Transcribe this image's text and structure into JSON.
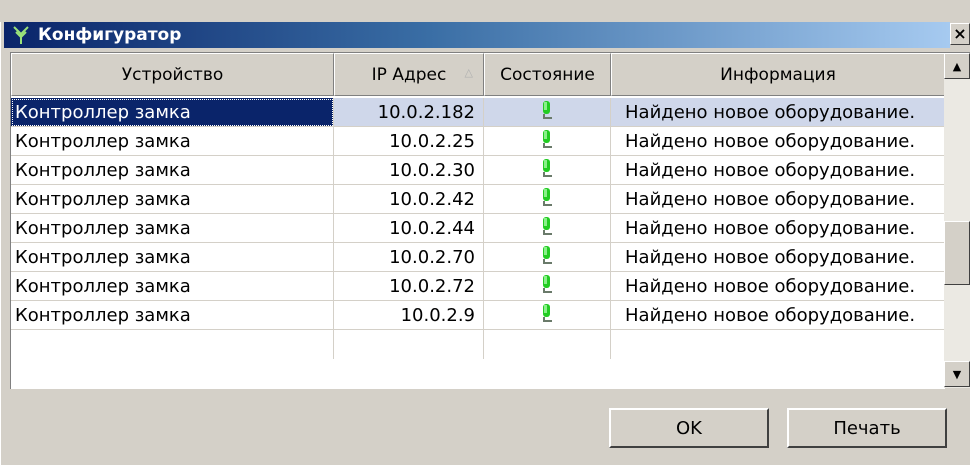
{
  "window": {
    "title": "Конфигуратор",
    "close_label": "×",
    "icon": "branch-network-icon"
  },
  "table": {
    "columns": [
      {
        "label": "Устройство"
      },
      {
        "label": "IP Адрес",
        "sort_indicator": "△"
      },
      {
        "label": "Состояние"
      },
      {
        "label": "Информация"
      }
    ],
    "rows": [
      {
        "device": "Контроллер замка",
        "ip": "10.0.2.182",
        "status_icon": "green-device-icon",
        "info": "Найдено новое оборудование."
      },
      {
        "device": "Контроллер замка",
        "ip": "10.0.2.25",
        "status_icon": "green-device-icon",
        "info": "Найдено новое оборудование."
      },
      {
        "device": "Контроллер замка",
        "ip": "10.0.2.30",
        "status_icon": "green-device-icon",
        "info": "Найдено новое оборудование."
      },
      {
        "device": "Контроллер замка",
        "ip": "10.0.2.42",
        "status_icon": "green-device-icon",
        "info": "Найдено новое оборудование."
      },
      {
        "device": "Контроллер замка",
        "ip": "10.0.2.44",
        "status_icon": "green-device-icon",
        "info": "Найдено новое оборудование."
      },
      {
        "device": "Контроллер замка",
        "ip": "10.0.2.70",
        "status_icon": "green-device-icon",
        "info": "Найдено новое оборудование."
      },
      {
        "device": "Контроллер замка",
        "ip": "10.0.2.72",
        "status_icon": "green-device-icon",
        "info": "Найдено новое оборудование."
      },
      {
        "device": "Контроллер замка",
        "ip": "10.0.2.9",
        "status_icon": "green-device-icon",
        "info": "Найдено новое оборудование."
      }
    ],
    "selected_row": 0
  },
  "scrollbar": {
    "up_arrow": "▲",
    "down_arrow": "▼"
  },
  "buttons": {
    "ok_label": "OK",
    "print_label": "Печать"
  },
  "colors": {
    "title_start": "#0a246a",
    "title_end": "#a6caf0",
    "selection": "#0a246a",
    "status_green": "#22cc22"
  }
}
